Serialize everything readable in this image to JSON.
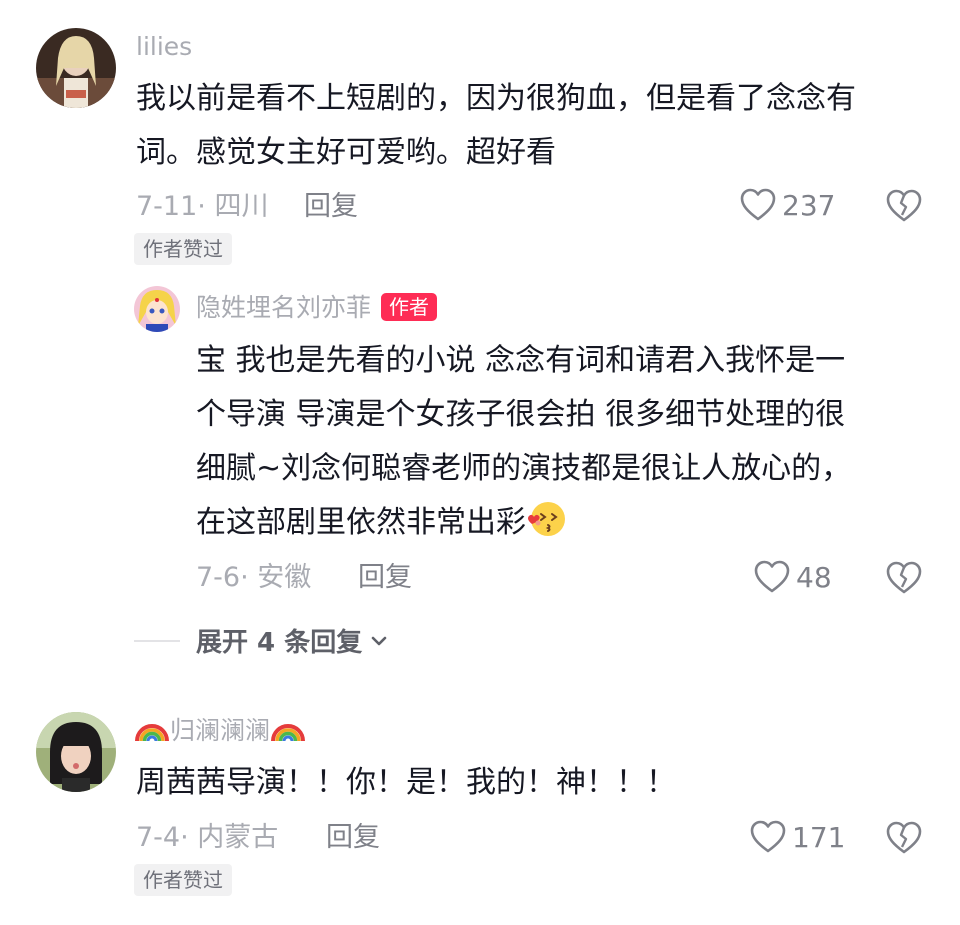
{
  "comments": [
    {
      "username": "lilies",
      "text_lines": [
        "我以前是看不上短剧的，因为很狗血，但是看了念念有",
        "词。感觉女主好可爱哟。超好看"
      ],
      "meta": "7-11· 四川",
      "reply_label": "回复",
      "likes": "237",
      "author_liked_badge": "作者赞过",
      "replies": [
        {
          "username": "隐姓埋名刘亦菲",
          "author_tag": "作者",
          "text_lines": [
            "宝 我也是先看的小说 念念有词和请君入我怀是一",
            "个导演 导演是个女孩子很会拍 很多细节处理的很",
            "细腻~刘念何聪睿老师的演技都是很让人放心的，",
            "在这部剧里依然非常出彩"
          ],
          "emoji": "kiss-emoji",
          "meta": "7-6· 安徽",
          "reply_label": "回复",
          "likes": "48"
        }
      ],
      "expand_label": "展开 4 条回复"
    },
    {
      "username": "归澜澜澜",
      "username_decor": "rainbow-emoji",
      "text_lines": [
        "周茜茜导演！！你！是！我的！神！！！"
      ],
      "meta": "7-4· 内蒙古",
      "reply_label": "回复",
      "likes": "171",
      "author_liked_badge": "作者赞过"
    }
  ],
  "colors": {
    "text": "#161823",
    "muted": "#a9abb2",
    "author_tag_bg": "#fe2c55"
  }
}
